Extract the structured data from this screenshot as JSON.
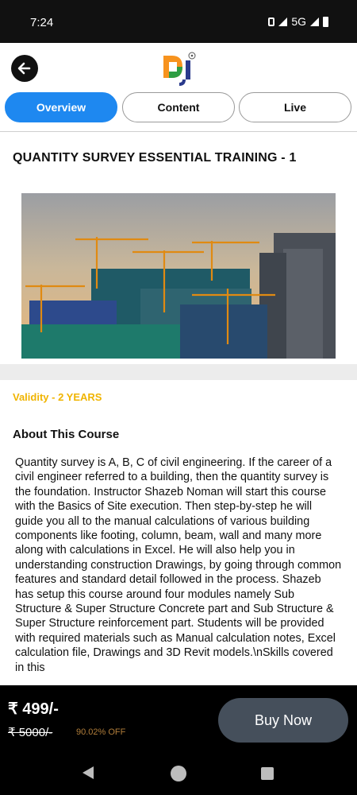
{
  "status_bar": {
    "time": "7:24",
    "network": "5G"
  },
  "header": {
    "back_icon": "arrow-left-icon",
    "logo_icon": "dj-logo-icon"
  },
  "tabs": [
    {
      "label": "Overview",
      "active": true
    },
    {
      "label": "Content",
      "active": false
    },
    {
      "label": "Live",
      "active": false
    }
  ],
  "course": {
    "title": "QUANTITY SURVEY ESSENTIAL TRAINING - 1",
    "validity": "Validity - 2 YEARS",
    "about_title": "About This Course",
    "about_text": "Quantity survey is A, B, C of civil engineering. If the career of a civil engineer referred to a building, then the quantity survey is the foundation. Instructor Shazeb Noman will start this course with the Basics of Site execution. Then step-by-step he will guide you all to the manual calculations of various building components like footing, column, beam, wall and many more along with calculations in Excel. He will also help you in understanding construction Drawings, by going through common features and standard detail followed in the process. Shazeb has setup this course around four modules namely Sub Structure & Super Structure Concrete part and Sub Structure & Super Structure reinforcement part. Students will be provided with required materials such as Manual calculation notes, Excel calculation file, Drawings and 3D Revit models.\\nSkills covered in this"
  },
  "purchase": {
    "price": "₹ 499/-",
    "old_price": "₹ 5000/-",
    "discount": "90.02% OFF",
    "buy_label": "Buy Now"
  },
  "colors": {
    "accent": "#1e88f0",
    "validity": "#f0b400",
    "discount": "#b07d3a",
    "buy_button": "#454f5b"
  }
}
